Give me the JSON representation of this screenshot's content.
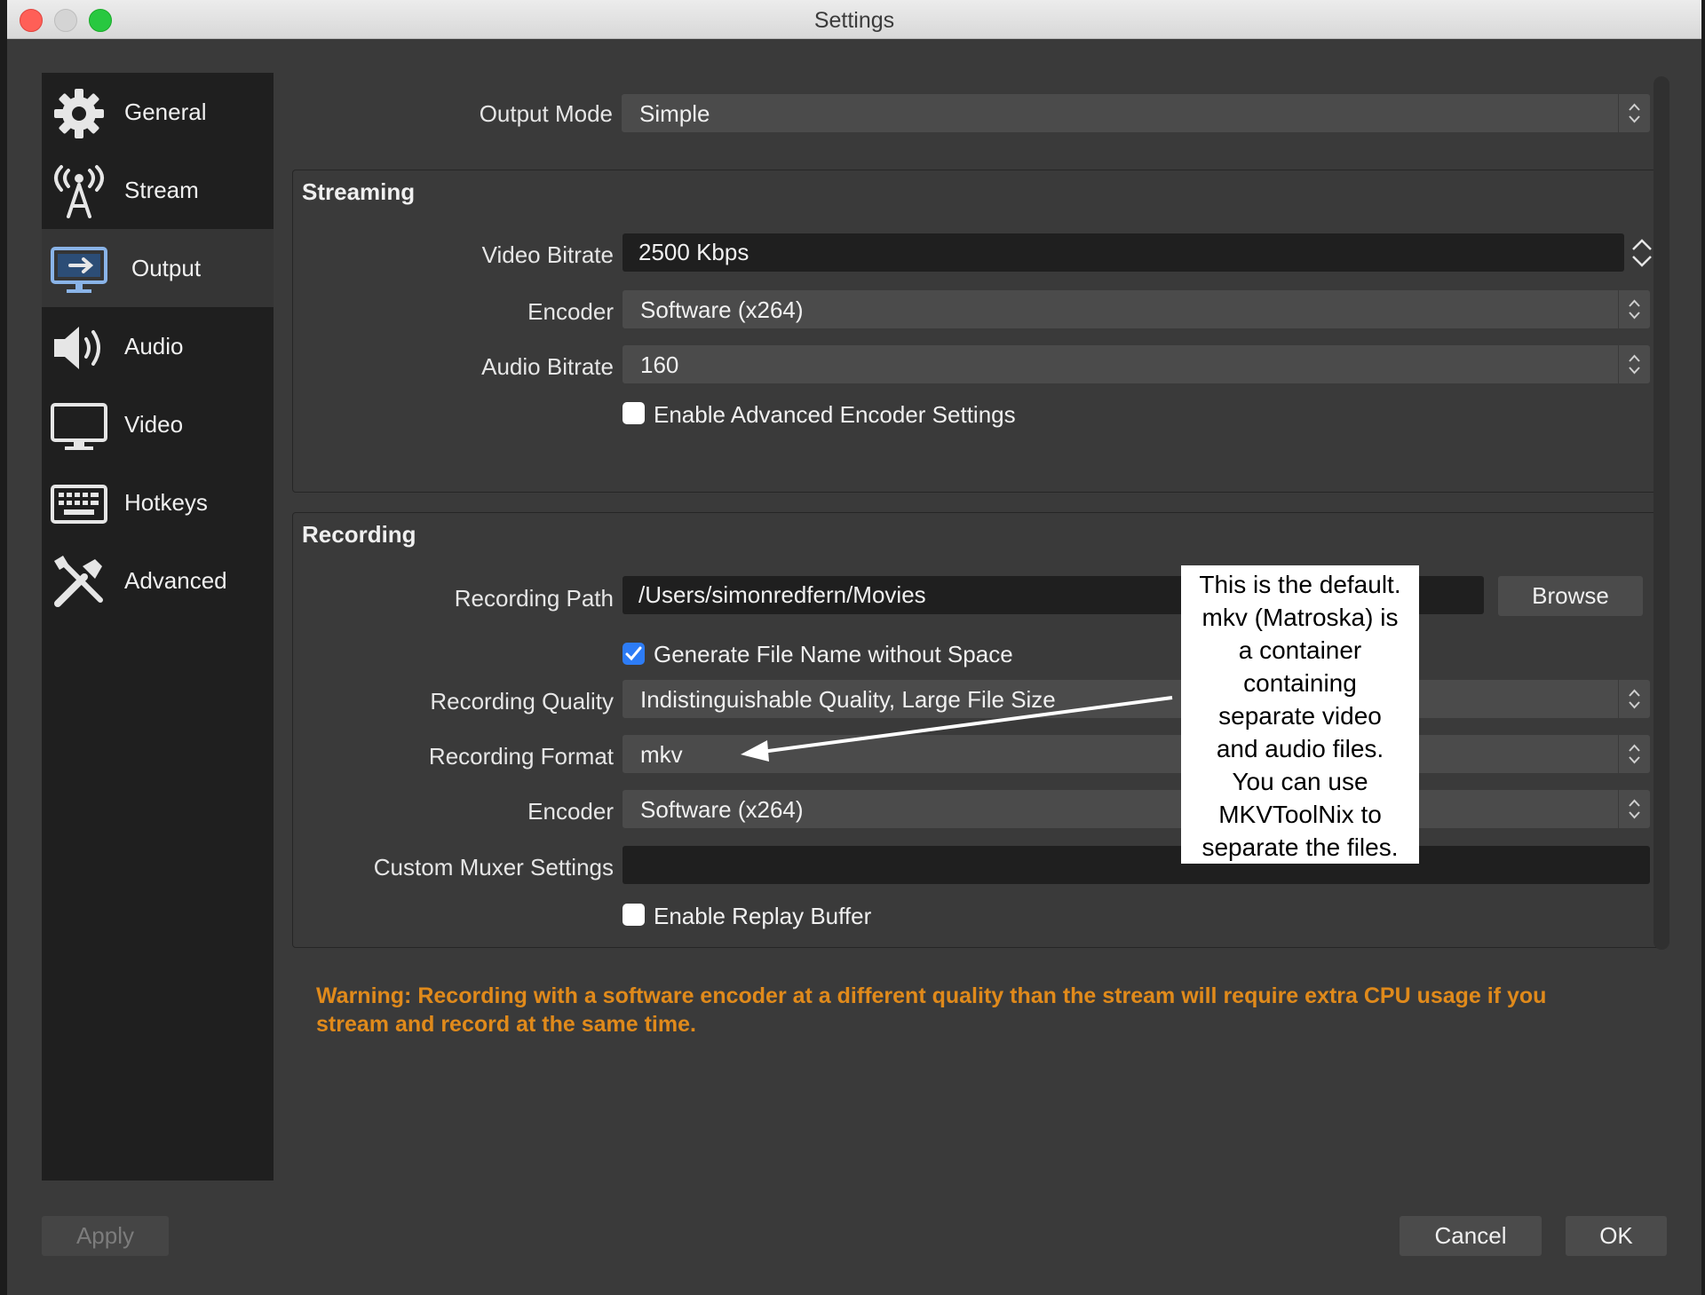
{
  "window": {
    "title": "Settings"
  },
  "sidebar": {
    "items": [
      {
        "label": "General",
        "icon": "gear-icon"
      },
      {
        "label": "Stream",
        "icon": "broadcast-tower-icon"
      },
      {
        "label": "Output",
        "icon": "monitor-output-icon",
        "active": true
      },
      {
        "label": "Audio",
        "icon": "speaker-icon"
      },
      {
        "label": "Video",
        "icon": "monitor-icon"
      },
      {
        "label": "Hotkeys",
        "icon": "keyboard-icon"
      },
      {
        "label": "Advanced",
        "icon": "tools-icon"
      }
    ]
  },
  "output_mode": {
    "label": "Output Mode",
    "value": "Simple"
  },
  "streaming": {
    "title": "Streaming",
    "video_bitrate": {
      "label": "Video Bitrate",
      "value": "2500 Kbps"
    },
    "encoder": {
      "label": "Encoder",
      "value": "Software (x264)"
    },
    "audio_bitrate": {
      "label": "Audio Bitrate",
      "value": "160"
    },
    "advanced_encoder": {
      "label": "Enable Advanced Encoder Settings",
      "checked": false
    }
  },
  "recording": {
    "title": "Recording",
    "path": {
      "label": "Recording Path",
      "value": "/Users/simonredfern/Movies"
    },
    "browse_label": "Browse",
    "no_space": {
      "label": "Generate File Name without Space",
      "checked": true
    },
    "quality": {
      "label": "Recording Quality",
      "value": "Indistinguishable Quality, Large File Size"
    },
    "format": {
      "label": "Recording Format",
      "value": "mkv"
    },
    "encoder": {
      "label": "Encoder",
      "value": "Software (x264)"
    },
    "muxer": {
      "label": "Custom Muxer Settings",
      "value": ""
    },
    "replay_buffer": {
      "label": "Enable Replay Buffer",
      "checked": false
    }
  },
  "warning": "Warning: Recording with a software encoder at a different quality than the stream will require extra CPU usage if you stream and record at the same time.",
  "annotation": {
    "lines": [
      "This is the default.",
      "mkv (Matroska) is",
      "a container",
      "containing",
      "separate video",
      "and audio files.",
      "You can use",
      "MKVToolNix to",
      "separate the files."
    ]
  },
  "footer": {
    "apply": "Apply",
    "cancel": "Cancel",
    "ok": "OK"
  },
  "colors": {
    "accent": "#2d7cf6",
    "warning": "#e08a1b",
    "active_nav": "#353535"
  }
}
